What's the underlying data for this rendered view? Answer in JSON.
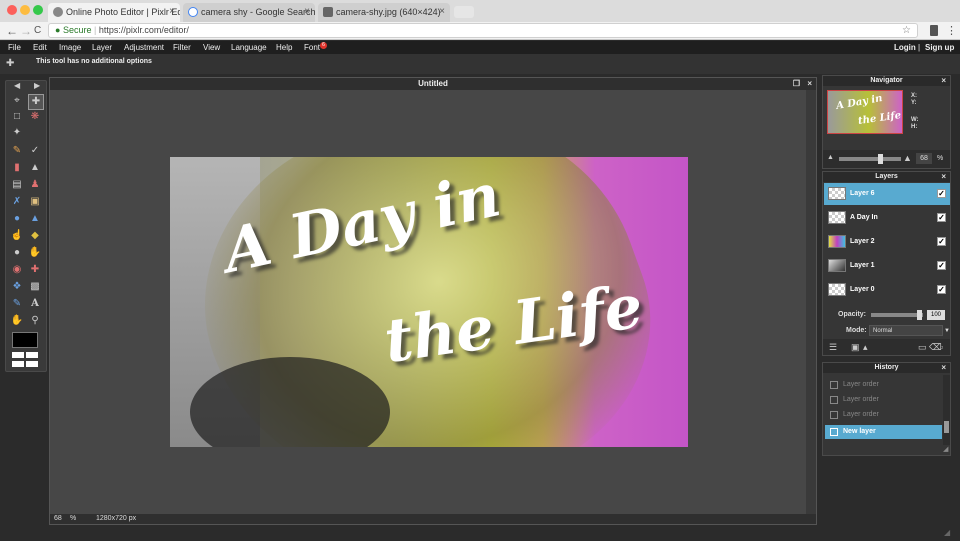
{
  "browser": {
    "tabs": [
      {
        "title": "Online Photo Editor | Pixlr Edit",
        "active": true
      },
      {
        "title": "camera shy - Google Search",
        "active": false
      },
      {
        "title": "camera-shy.jpg (640×424)",
        "active": false
      }
    ],
    "close_glyph": "×",
    "address": {
      "secure_label": "Secure",
      "url": "https://pixlr.com/editor/"
    },
    "nav": {
      "back": "←",
      "forward": "→",
      "reload": "C",
      "star": "☆",
      "menu": "⋮"
    }
  },
  "menu": {
    "items": [
      "File",
      "Edit",
      "Image",
      "Layer",
      "Adjustment",
      "Filter",
      "View",
      "Language",
      "Help",
      "Font"
    ],
    "font_badge": "6",
    "login": "Login",
    "separator": "|",
    "signup": "Sign up"
  },
  "options": {
    "message": "This tool has no additional options"
  },
  "document": {
    "title": "Untitled",
    "zoom": "68",
    "zoom_unit": "%",
    "size": "1280x720 px",
    "image_text_line1": "A Day in",
    "image_text_line2": "the Life"
  },
  "navigator": {
    "title": "Navigator",
    "x_label": "X:",
    "y_label": "Y:",
    "w_label": "W:",
    "h_label": "H:",
    "zoom": "68",
    "zoom_unit": "%",
    "zoom_fraction": 0.68
  },
  "layers": {
    "title": "Layers",
    "items": [
      {
        "name": "Layer 6",
        "selected": true
      },
      {
        "name": "A Day In",
        "selected": false
      },
      {
        "name": "Layer 2",
        "selected": false
      },
      {
        "name": "Layer 1",
        "selected": false
      },
      {
        "name": "Layer 0",
        "selected": false
      }
    ],
    "check_glyph": "✓",
    "opacity_label": "Opacity:",
    "opacity_value": "100",
    "mode_label": "Mode:",
    "mode_value": "Normal"
  },
  "history": {
    "title": "History",
    "items": [
      {
        "name": "Layer order",
        "selected": false
      },
      {
        "name": "Layer order",
        "selected": false
      },
      {
        "name": "Layer order",
        "selected": false
      },
      {
        "name": "New layer",
        "selected": true
      }
    ]
  },
  "colors": {
    "accent": "#58aad0",
    "badge": "#e0332b",
    "foreground": "#000000",
    "background": "#ffffff"
  }
}
